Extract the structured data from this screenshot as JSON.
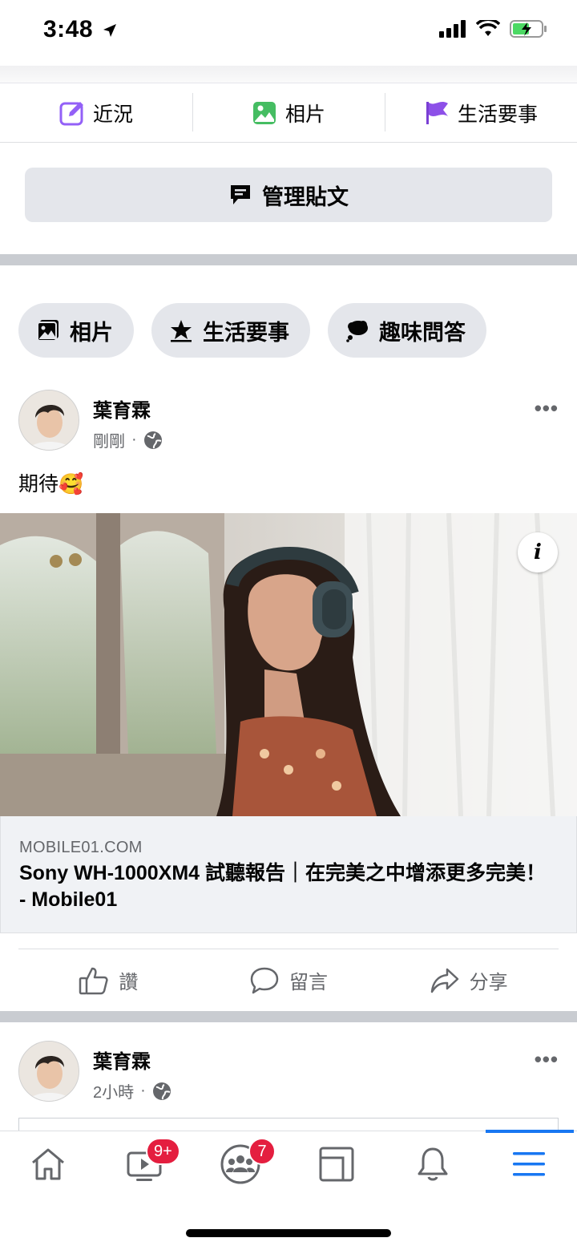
{
  "status_bar": {
    "time": "3:48"
  },
  "composer": {
    "items": [
      {
        "label": "近況",
        "icon": "edit-icon"
      },
      {
        "label": "相片",
        "icon": "photo-icon"
      },
      {
        "label": "生活要事",
        "icon": "flag-icon"
      }
    ],
    "manage_posts_label": "管理貼文"
  },
  "filter_chips": [
    {
      "label": "相片",
      "icon": "photo-icon"
    },
    {
      "label": "生活要事",
      "icon": "star-icon"
    },
    {
      "label": "趣味問答",
      "icon": "chat-bubble-icon"
    }
  ],
  "posts": [
    {
      "author": "葉育霖",
      "time": "剛剛",
      "text": "期待🥰",
      "link": {
        "domain": "MOBILE01.COM",
        "title": "Sony WH-1000XM4 試聽報告｜在完美之中增添更多完美！ - Mobile01"
      },
      "actions": {
        "like": "讚",
        "comment": "留言",
        "share": "分享"
      }
    },
    {
      "author": "葉育霖",
      "time": "2小時"
    }
  ],
  "tab_bar": {
    "watch_badge": "9+",
    "groups_badge": "7"
  }
}
